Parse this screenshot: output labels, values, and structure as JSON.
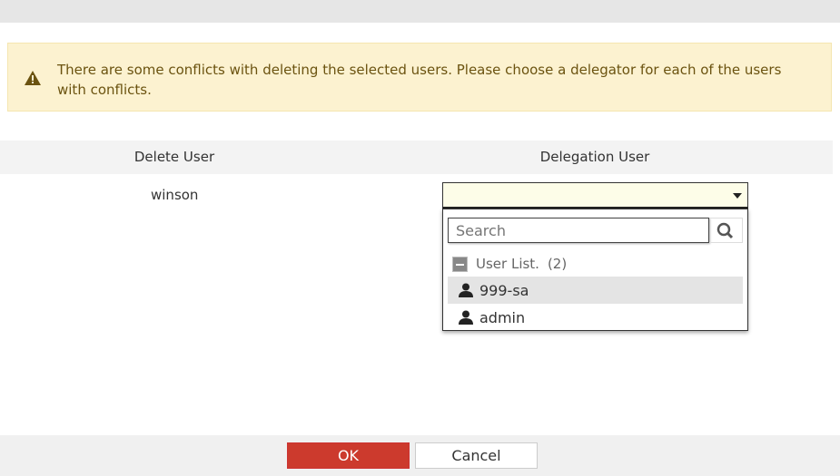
{
  "alert": {
    "message": "There are some conflicts with deleting the selected users. Please choose a delegator for each of the users with conflicts.",
    "icon": "warning-icon"
  },
  "table": {
    "headers": [
      "Delete User",
      "Delegation User"
    ],
    "rows": [
      {
        "delete_user": "winson",
        "delegation_user": ""
      }
    ]
  },
  "dropdown": {
    "search_placeholder": "Search",
    "group_label": "User List.",
    "group_count": "(2)",
    "items": [
      "999-sa",
      "admin"
    ],
    "highlighted": "999-sa"
  },
  "footer": {
    "ok_label": "OK",
    "cancel_label": "Cancel"
  },
  "colors": {
    "ok": "#cc3a2d",
    "alert_bg": "#fcf2d0",
    "alert_text": "#6b5310"
  }
}
